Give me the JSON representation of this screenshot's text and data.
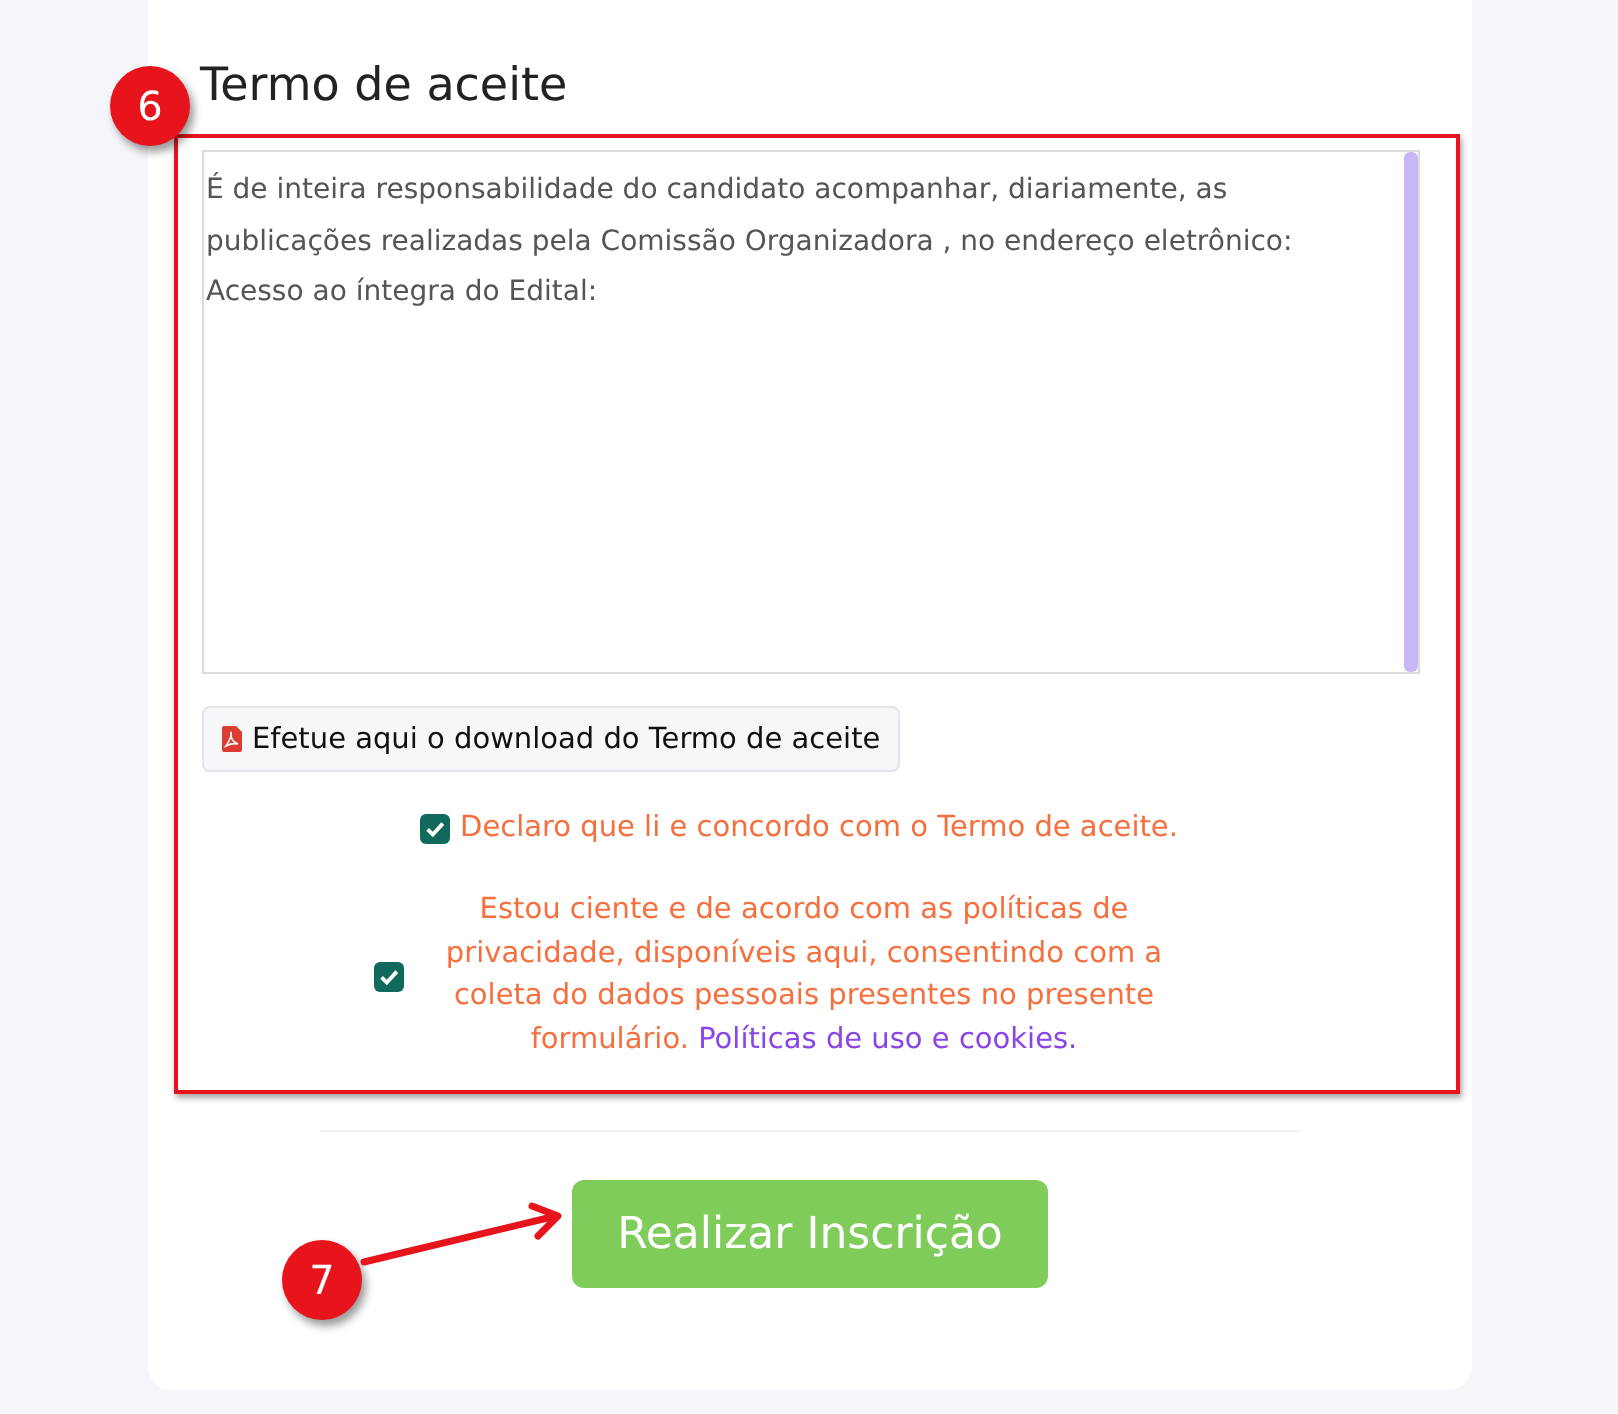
{
  "section_title": "Termo de aceite",
  "terms_text": [
    "É de inteira responsabilidade do candidato acompanhar, diariamente, as publicações realizadas pela Comissão Organizadora , no endereço eletrônico:",
    "Acesso ao íntegra do Edital:"
  ],
  "download_button": "Efetue aqui o download do Termo de aceite",
  "agreements": [
    {
      "label": "Declaro que li e concordo com o Termo de aceite.",
      "checked": true
    },
    {
      "label": "Estou ciente e de acordo com as políticas de privacidade, disponíveis aqui, consentindo com a coleta do dados pessoais presentes no presente formulário.",
      "link": "Políticas de uso e cookies.",
      "checked": true
    }
  ],
  "submit_button": "Realizar Inscrição",
  "callouts": [
    {
      "number": "6"
    },
    {
      "number": "7"
    }
  ]
}
